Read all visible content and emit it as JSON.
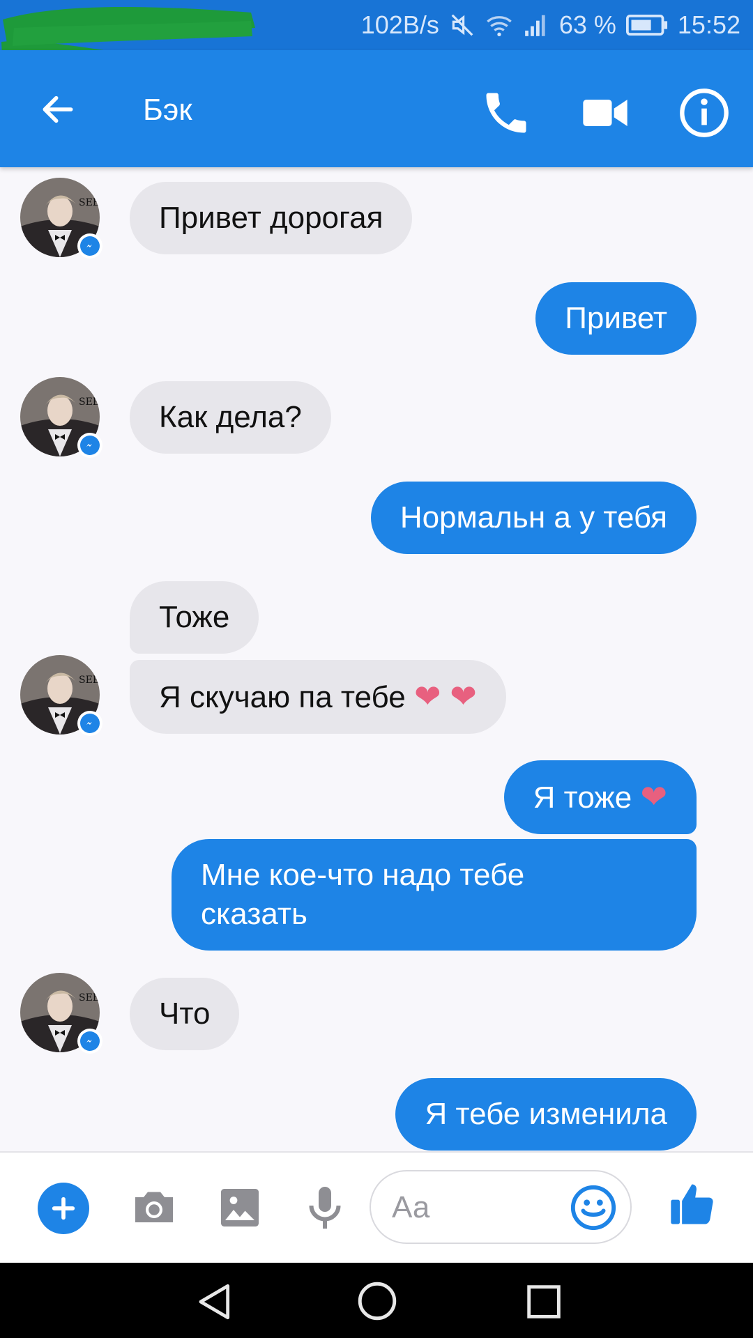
{
  "status_bar": {
    "net_speed": "102B/s",
    "battery": "63 %",
    "time": "15:52",
    "icons": [
      "mute-icon",
      "wifi-icon",
      "signal-icon",
      "battery-icon"
    ]
  },
  "header": {
    "contact_name": "Бэк",
    "icons": [
      "back-arrow-icon",
      "phone-icon",
      "video-camera-icon",
      "info-icon"
    ]
  },
  "messages": [
    {
      "from": "contact",
      "text": "Привет дорогая"
    },
    {
      "from": "me",
      "text": "Привет"
    },
    {
      "from": "contact",
      "text": "Как дела?"
    },
    {
      "from": "me",
      "text": "Нормальн а у тебя"
    },
    {
      "from": "contact",
      "text": "Тоже"
    },
    {
      "from": "contact",
      "text": "Я скучаю па тебе",
      "emoji": "❤ ❤"
    },
    {
      "from": "me",
      "text": "Я тоже",
      "emoji": "❤"
    },
    {
      "from": "me",
      "text": "Мне кое-что надо тебе",
      "text2": "сказать"
    },
    {
      "from": "contact",
      "text": "Что"
    },
    {
      "from": "me",
      "text": "Я тебе изменила"
    }
  ],
  "composer": {
    "placeholder": "Аа",
    "icons": [
      "plus-icon",
      "camera-icon",
      "gallery-icon",
      "microphone-icon",
      "emoji-icon",
      "thumbs-up-icon"
    ]
  },
  "colors": {
    "status_bar": "#1874d6",
    "header": "#1e84e6",
    "outgoing_bubble": "#1e84e6",
    "incoming_bubble": "#e7e6eb",
    "heart": "#e8607f",
    "background": "#f8f7fb"
  }
}
